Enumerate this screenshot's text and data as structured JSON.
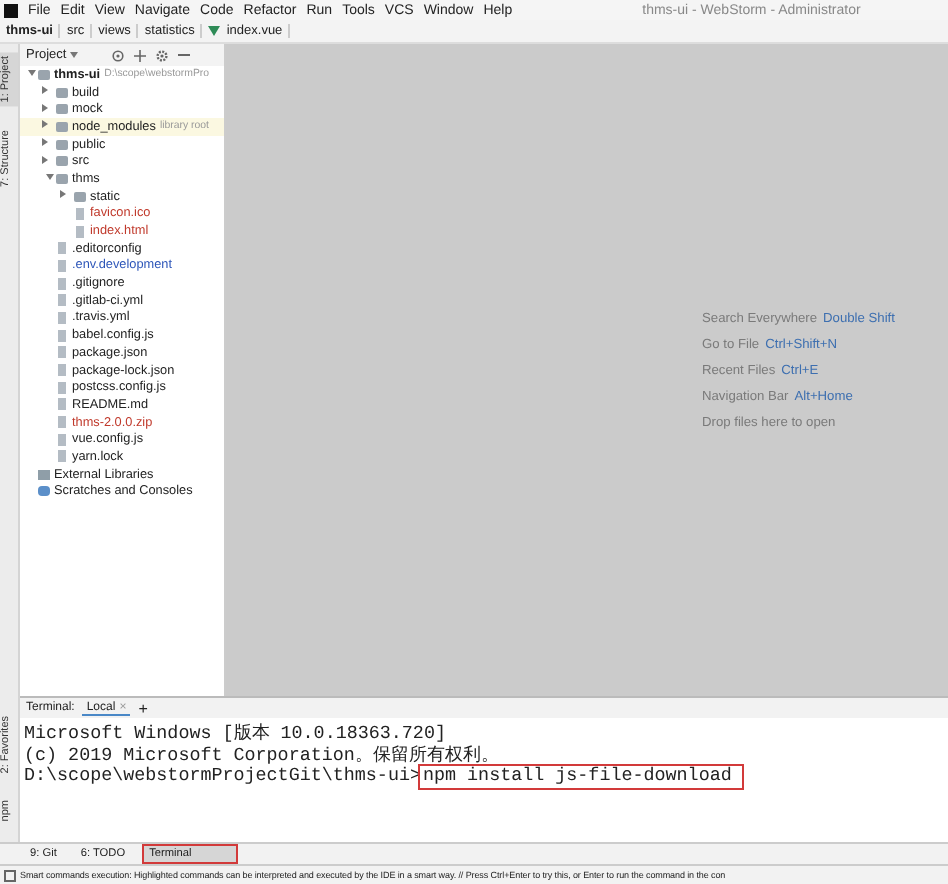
{
  "window": {
    "title": "thms-ui - WebStorm - Administrator"
  },
  "menu": [
    "File",
    "Edit",
    "View",
    "Navigate",
    "Code",
    "Refactor",
    "Run",
    "Tools",
    "VCS",
    "Window",
    "Help"
  ],
  "breadcrumb": [
    "thms-ui",
    "src",
    "views",
    "statistics",
    "index.vue"
  ],
  "left_stripe": [
    {
      "label": "1: Project",
      "selected": true
    },
    {
      "label": "7: Structure",
      "selected": false
    },
    {
      "label": "2: Favorites",
      "selected": false
    },
    {
      "label": "npm",
      "selected": false
    }
  ],
  "project": {
    "title": "Project",
    "tree": [
      {
        "label": "thms-ui",
        "kind": "folder",
        "bold": true,
        "note": "D:\\scope\\webstormPro",
        "expanded": true,
        "children": [
          {
            "label": "build",
            "kind": "folder",
            "expanded": false
          },
          {
            "label": "mock",
            "kind": "folder",
            "expanded": false
          },
          {
            "label": "node_modules",
            "kind": "folder",
            "note": "library root",
            "library": true,
            "expanded": false
          },
          {
            "label": "public",
            "kind": "folder",
            "expanded": false
          },
          {
            "label": "src",
            "kind": "folder",
            "expanded": false
          },
          {
            "label": "thms",
            "kind": "folder",
            "expanded": true,
            "children": [
              {
                "label": "static",
                "kind": "folder",
                "expanded": false
              },
              {
                "label": "favicon.ico",
                "kind": "file",
                "color": "#c0392b"
              },
              {
                "label": "index.html",
                "kind": "file",
                "color": "#c0392b"
              }
            ]
          },
          {
            "label": ".editorconfig",
            "kind": "file"
          },
          {
            "label": ".env.development",
            "kind": "file",
            "color": "#2c55b8"
          },
          {
            "label": ".gitignore",
            "kind": "file"
          },
          {
            "label": ".gitlab-ci.yml",
            "kind": "file"
          },
          {
            "label": ".travis.yml",
            "kind": "file"
          },
          {
            "label": "babel.config.js",
            "kind": "file"
          },
          {
            "label": "package.json",
            "kind": "file"
          },
          {
            "label": "package-lock.json",
            "kind": "file"
          },
          {
            "label": "postcss.config.js",
            "kind": "file"
          },
          {
            "label": "README.md",
            "kind": "file"
          },
          {
            "label": "thms-2.0.0.zip",
            "kind": "file",
            "color": "#c0392b"
          },
          {
            "label": "vue.config.js",
            "kind": "file"
          },
          {
            "label": "yarn.lock",
            "kind": "file"
          }
        ]
      },
      {
        "label": "External Libraries",
        "kind": "library"
      },
      {
        "label": "Scratches and Consoles",
        "kind": "scratch"
      }
    ]
  },
  "editor_hints": [
    {
      "label": "Search Everywhere",
      "shortcut": "Double Shift"
    },
    {
      "label": "Go to File",
      "shortcut": "Ctrl+Shift+N"
    },
    {
      "label": "Recent Files",
      "shortcut": "Ctrl+E"
    },
    {
      "label": "Navigation Bar",
      "shortcut": "Alt+Home"
    },
    {
      "label": "Drop files here to open"
    }
  ],
  "terminal": {
    "title": "Terminal:",
    "tabs": [
      {
        "label": "Local",
        "close": "×",
        "selected": true
      }
    ],
    "add": "+",
    "lines": [
      {
        "text": "Microsoft Windows [版本 10.0.18363.720]"
      },
      {
        "text": "(c) 2019 Microsoft Corporation。保留所有权利。"
      },
      {
        "text": "D:\\scope\\webstormProjectGit\\thms-ui>",
        "command": "npm install js-file-download",
        "highlighted": true
      }
    ]
  },
  "tool_tabs": [
    {
      "label": "9: Git",
      "selected": false,
      "highlighted": false
    },
    {
      "label": "6: TODO",
      "selected": false,
      "highlighted": false
    },
    {
      "label": "Terminal",
      "selected": true,
      "highlighted": true
    }
  ],
  "status_bar": "Smart commands execution: Highlighted commands can be interpreted and executed by the IDE in a smart way. // Press Ctrl+Enter to try this, or Enter to run the command in the con"
}
